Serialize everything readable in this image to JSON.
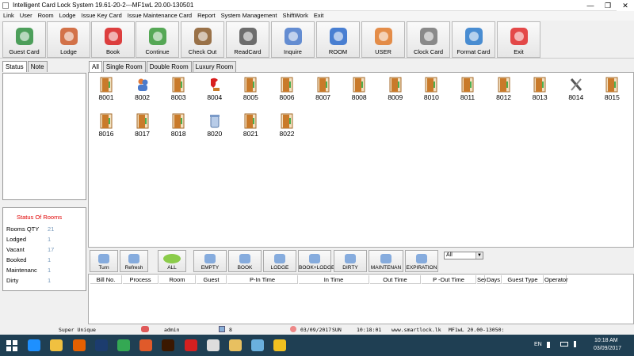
{
  "window": {
    "title": "Intelligent Card Lock System 19.61-20-2---MF1wL 20.00-130501",
    "min": "—",
    "max": "❐",
    "close": "✕"
  },
  "menu": [
    "Link",
    "User",
    "Room",
    "Lodge",
    "Issue Key Card",
    "Issue Maintenance Card",
    "Report",
    "System Management",
    "ShiftWork",
    "Exit"
  ],
  "toolbar": [
    {
      "label": "Guest Card",
      "icon": "guest-card-icon",
      "color": "#2f8f3f"
    },
    {
      "label": "Lodge",
      "icon": "lodge-people-icon",
      "color": "#cc5a2a"
    },
    {
      "label": "Book",
      "icon": "phone-icon",
      "color": "#d81f1f"
    },
    {
      "label": "Continue",
      "icon": "continue-arrow-icon",
      "color": "#3a9a3a"
    },
    {
      "label": "Check Out",
      "icon": "door-exit-icon",
      "color": "#8a5a2a"
    },
    {
      "label": "ReadCard",
      "icon": "card-reader-icon",
      "color": "#555555"
    },
    {
      "label": "Inquire",
      "icon": "magnifier-icon",
      "color": "#4a7acb"
    },
    {
      "label": "ROOM",
      "icon": "house-gear-icon",
      "color": "#2a6acb"
    },
    {
      "label": "USER",
      "icon": "user-icon",
      "color": "#e07a2a"
    },
    {
      "label": "Clock Card",
      "icon": "clock-icon",
      "color": "#777777"
    },
    {
      "label": "Format Card",
      "icon": "format-card-icon",
      "color": "#2a7acb"
    },
    {
      "label": "Exit",
      "icon": "power-icon",
      "color": "#e02a2a"
    }
  ],
  "left_tabs": [
    "Status",
    "Note"
  ],
  "room_tabs": [
    "All",
    "Single Room",
    "Double Room",
    "Luxury Room"
  ],
  "status": {
    "title": "Status Of Rooms",
    "rows": [
      {
        "label": "Rooms QTY",
        "value": "21"
      },
      {
        "label": "Lodged",
        "value": "1"
      },
      {
        "label": "Vacant",
        "value": "17"
      },
      {
        "label": "Booked",
        "value": "1"
      },
      {
        "label": "Maintenanc",
        "value": "1"
      },
      {
        "label": "Dirty",
        "value": "1"
      }
    ]
  },
  "rooms": [
    {
      "number": "8001",
      "state": "empty"
    },
    {
      "number": "8002",
      "state": "lodged"
    },
    {
      "number": "8003",
      "state": "empty"
    },
    {
      "number": "8004",
      "state": "booked"
    },
    {
      "number": "8005",
      "state": "empty"
    },
    {
      "number": "8006",
      "state": "empty"
    },
    {
      "number": "8007",
      "state": "empty"
    },
    {
      "number": "8008",
      "state": "empty"
    },
    {
      "number": "8009",
      "state": "empty"
    },
    {
      "number": "8010",
      "state": "empty"
    },
    {
      "number": "8011",
      "state": "empty"
    },
    {
      "number": "8012",
      "state": "empty"
    },
    {
      "number": "8013",
      "state": "empty"
    },
    {
      "number": "8014",
      "state": "maintenance"
    },
    {
      "number": "8015",
      "state": "empty"
    },
    {
      "number": "8016",
      "state": "empty"
    },
    {
      "number": "8017",
      "state": "empty"
    },
    {
      "number": "8018",
      "state": "empty"
    },
    {
      "number": "8020",
      "state": "dirty"
    },
    {
      "number": "8021",
      "state": "empty"
    },
    {
      "number": "8022",
      "state": "empty"
    }
  ],
  "filters": [
    {
      "label": "Turn",
      "icon": "turn-icon"
    },
    {
      "label": "Refresh",
      "icon": "refresh-icon"
    },
    {
      "label": "ALL",
      "icon": "all-oval-icon"
    },
    {
      "label": "EMPTY",
      "icon": "empty-door-icon"
    },
    {
      "label": "BOOK",
      "icon": "book-phone-icon"
    },
    {
      "label": "LODGE",
      "icon": "lodge-icon"
    },
    {
      "label": "BOOK+LODGE",
      "icon": "book-lodge-icon"
    },
    {
      "label": "DIRTY",
      "icon": "dirty-icon"
    },
    {
      "label": "MAINTENAN",
      "icon": "maintenance-icon"
    },
    {
      "label": "EXPIRATION",
      "icon": "expiration-icon"
    }
  ],
  "filter_select": "All",
  "columns": [
    "Bill No.",
    "Process",
    "Room",
    "Guest",
    "P-In Time",
    "In Time",
    "Out Time",
    "P -Out Time",
    "Sex",
    "Days",
    "Guest Type",
    "Operator"
  ],
  "statusbar": {
    "company": "Super Unique",
    "user": "admin",
    "count": "8",
    "date": "03/09/2017",
    "day": "SUN",
    "time": "10:18:01",
    "website": "www.smartlock.lk",
    "version": "MF1wL 20.00-13050:"
  },
  "taskbar": {
    "apps": [
      {
        "name": "windows-start-icon",
        "color": "#ffffff"
      },
      {
        "name": "internet-explorer-icon",
        "color": "#1e90ff"
      },
      {
        "name": "file-explorer-icon",
        "color": "#f0c040"
      },
      {
        "name": "firefox-icon",
        "color": "#e66000"
      },
      {
        "name": "photoshop-icon",
        "color": "#1c3c6e"
      },
      {
        "name": "chrome-icon",
        "color": "#34a853"
      },
      {
        "name": "media-player-icon",
        "color": "#e05a2a"
      },
      {
        "name": "illustrator-icon",
        "color": "#3b1800"
      },
      {
        "name": "acrobat-icon",
        "color": "#d42020"
      },
      {
        "name": "document-icon",
        "color": "#dddddd"
      },
      {
        "name": "folder-icon",
        "color": "#e8c060"
      },
      {
        "name": "window-icon",
        "color": "#6ab0de"
      },
      {
        "name": "lock-app-icon",
        "color": "#f0c020"
      }
    ],
    "lang": "EN",
    "time": "10:18 AM",
    "date": "03/09/2017"
  }
}
